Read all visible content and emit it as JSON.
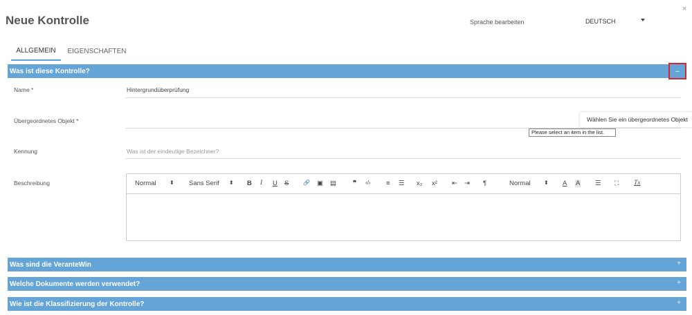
{
  "header": {
    "title": "Neue Kontrolle",
    "language_label": "Sprache bearbeiten",
    "language_value": "DEUTSCH",
    "close_symbol": "×"
  },
  "tabs": [
    {
      "label": "ALLGEMEIN",
      "active": true
    },
    {
      "label": "EIGENSCHAFTEN",
      "active": false
    }
  ],
  "sections": [
    {
      "title": "Was ist diese Kontrolle?",
      "toggle": "–",
      "expanded": true
    },
    {
      "title": "Was sind die VeranteWin",
      "toggle": "+",
      "expanded": false
    },
    {
      "title": "Welche Dokumente werden verwendet?",
      "toggle": "+",
      "expanded": false
    },
    {
      "title": "Wie ist die Klassifizierung der Kontrolle?",
      "toggle": "+",
      "expanded": false
    }
  ],
  "form": {
    "name_label": "Name *",
    "name_value": "Hintergrundüberprüfung",
    "parent_label": "Übergeordnetes Objekt  *",
    "parent_hint": "Wählen Sie ein übergeordnetes Objekt",
    "validation_tooltip": "Please select an item in the list.",
    "id_label": "Kennung",
    "id_placeholder": "Was ist der eindeutige Bezeichner?",
    "description_label": "Beschreibung"
  },
  "editor_toolbar": {
    "format": "Normal",
    "font": "Sans Serif",
    "size": "Normal",
    "select_caret": "⬍",
    "bold": "B",
    "italic": "I",
    "underline": "U",
    "strike": "S",
    "link": "🔗",
    "image": "▣",
    "video": "▤",
    "quote": "❞",
    "code": "‹/›",
    "ordered_list": "≡",
    "bullet_list": "☰",
    "subscript": "x₂",
    "superscript": "x²",
    "outdent": "⇤",
    "indent": "⇥",
    "direction": "¶",
    "text_color": "A",
    "background_color": "A",
    "align": "☰",
    "fullscreen": "⛶",
    "clear_format": "Tx"
  },
  "colors": {
    "accent_bar": "#64a4d6",
    "tab_underline": "#5a9fd4",
    "highlight_box": "#d9262c"
  }
}
